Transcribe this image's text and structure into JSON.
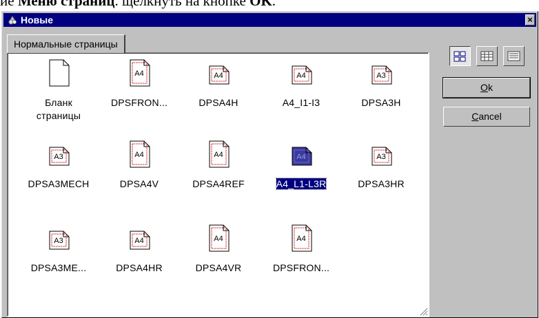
{
  "caption": {
    "lead": "ие ",
    "bold_menu": "Меню страниц",
    "middle": ". щелкнуть на кнопке ",
    "bold_ok": "OK",
    "tail": "."
  },
  "window": {
    "title": "Новые",
    "close_glyph": "×",
    "tab_label": "Нормальные страницы"
  },
  "items": [
    {
      "label": "Бланк страницы",
      "badge": ""
    },
    {
      "label": "DPSFRON...",
      "badge": "A4"
    },
    {
      "label": "DPSA4H",
      "badge": "A4"
    },
    {
      "label": "A4_I1-I3",
      "badge": "A4"
    },
    {
      "label": "DPSA3H",
      "badge": "A3"
    },
    {
      "label": "DPSA3MECH",
      "badge": "A3"
    },
    {
      "label": "DPSA4V",
      "badge": "A4"
    },
    {
      "label": "DPSA4REF",
      "badge": "A4"
    },
    {
      "label": "A4_L1-L3R",
      "badge": "A4",
      "selected": true
    },
    {
      "label": "DPSA3HR",
      "badge": "A3"
    },
    {
      "label": "DPSA3ME...",
      "badge": "A3"
    },
    {
      "label": "DPSA4HR",
      "badge": "A4"
    },
    {
      "label": "DPSA4VR",
      "badge": "A4"
    },
    {
      "label": "DPSFRON...",
      "badge": "A4"
    }
  ],
  "buttons": {
    "ok_label": "Ok",
    "ok_mnemonic": "O",
    "ok_rest": "k",
    "cancel_label": "Cancel",
    "cancel_mnemonic": "C",
    "cancel_rest": "ancel"
  },
  "view_modes": {
    "active": "large-icons"
  },
  "colors": {
    "title_bar": "#000080",
    "selection": "#000080",
    "face": "#c0c0c0",
    "badge_dash": "#cc0000"
  }
}
